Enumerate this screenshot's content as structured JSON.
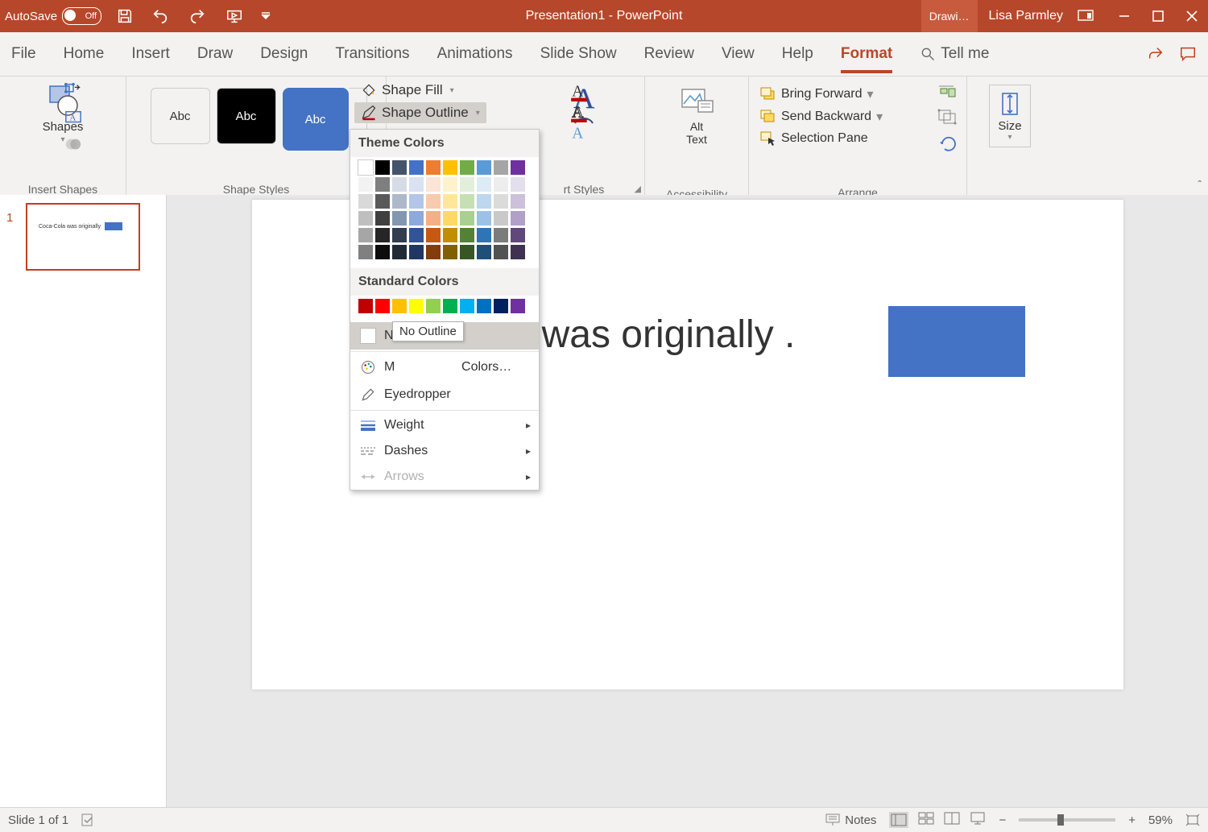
{
  "title_bar": {
    "autosave_label": "AutoSave",
    "autosave_state": "Off",
    "doc_title": "Presentation1  -  PowerPoint",
    "contextual_tab": "Drawi…",
    "user_name": "Lisa Parmley"
  },
  "tabs": {
    "items": [
      "File",
      "Home",
      "Insert",
      "Draw",
      "Design",
      "Transitions",
      "Animations",
      "Slide Show",
      "Review",
      "View",
      "Help",
      "Format"
    ],
    "active": "Format",
    "tell_me": "Tell me"
  },
  "ribbon": {
    "insert_shapes": {
      "label": "Insert Shapes",
      "button": "Shapes"
    },
    "shape_styles": {
      "label": "Shape Styles",
      "thumb_text": "Abc",
      "shape_fill": "Shape Fill",
      "shape_outline": "Shape Outline"
    },
    "wordart": {
      "label": "rt Styles"
    },
    "accessibility": {
      "label": "Accessibility",
      "button_line1": "Alt",
      "button_line2": "Text"
    },
    "arrange": {
      "label": "Arrange",
      "bring_forward": "Bring Forward",
      "send_backward": "Send Backward",
      "selection_pane": "Selection Pane"
    },
    "size": {
      "label": "Size"
    }
  },
  "dropdown": {
    "theme_colors": "Theme Colors",
    "standard_colors": "Standard Colors",
    "no_outline": "No Outline",
    "more_colors_prefix": "M",
    "more_colors_suffix": " Colors…",
    "eyedropper": "Eyedropper",
    "weight": "Weight",
    "dashes": "Dashes",
    "arrows": "Arrows",
    "tooltip": "No Outline",
    "theme_grid": [
      [
        "#ffffff",
        "#000000",
        "#44546a",
        "#4472c4",
        "#ed7d31",
        "#ffc000",
        "#70ad47",
        "#5b9bd5",
        "#a5a5a5",
        "#7030a0"
      ],
      [
        "#f2f2f2",
        "#7f7f7f",
        "#d6dce5",
        "#d9e1f2",
        "#fce4d6",
        "#fff2cc",
        "#e2efda",
        "#ddebf7",
        "#ededed",
        "#e4dfec"
      ],
      [
        "#d9d9d9",
        "#595959",
        "#adb9ca",
        "#b4c6e7",
        "#f8cbad",
        "#ffe699",
        "#c6e0b4",
        "#bdd7ee",
        "#dbdbdb",
        "#ccc0da"
      ],
      [
        "#bfbfbf",
        "#404040",
        "#8497b0",
        "#8ea9db",
        "#f4b084",
        "#ffd966",
        "#a9d08e",
        "#9bc2e6",
        "#c9c9c9",
        "#b1a0c7"
      ],
      [
        "#a6a6a6",
        "#262626",
        "#333f4f",
        "#305496",
        "#c65911",
        "#bf8f00",
        "#548235",
        "#2f75b5",
        "#7b7b7b",
        "#60497a"
      ],
      [
        "#808080",
        "#0d0d0d",
        "#222b35",
        "#203764",
        "#833c0c",
        "#806000",
        "#375623",
        "#1f4e78",
        "#525252",
        "#403151"
      ]
    ],
    "standard_row": [
      "#c00000",
      "#ff0000",
      "#ffc000",
      "#ffff00",
      "#92d050",
      "#00b050",
      "#00b0f0",
      "#0070c0",
      "#002060",
      "#7030a0"
    ]
  },
  "slide": {
    "number": "1",
    "text": "Coca-Cola was originally              .",
    "thumb_text": "Coca-Cola was originally"
  },
  "status": {
    "slide_counter": "Slide 1 of 1",
    "notes": "Notes",
    "zoom": "59%"
  }
}
